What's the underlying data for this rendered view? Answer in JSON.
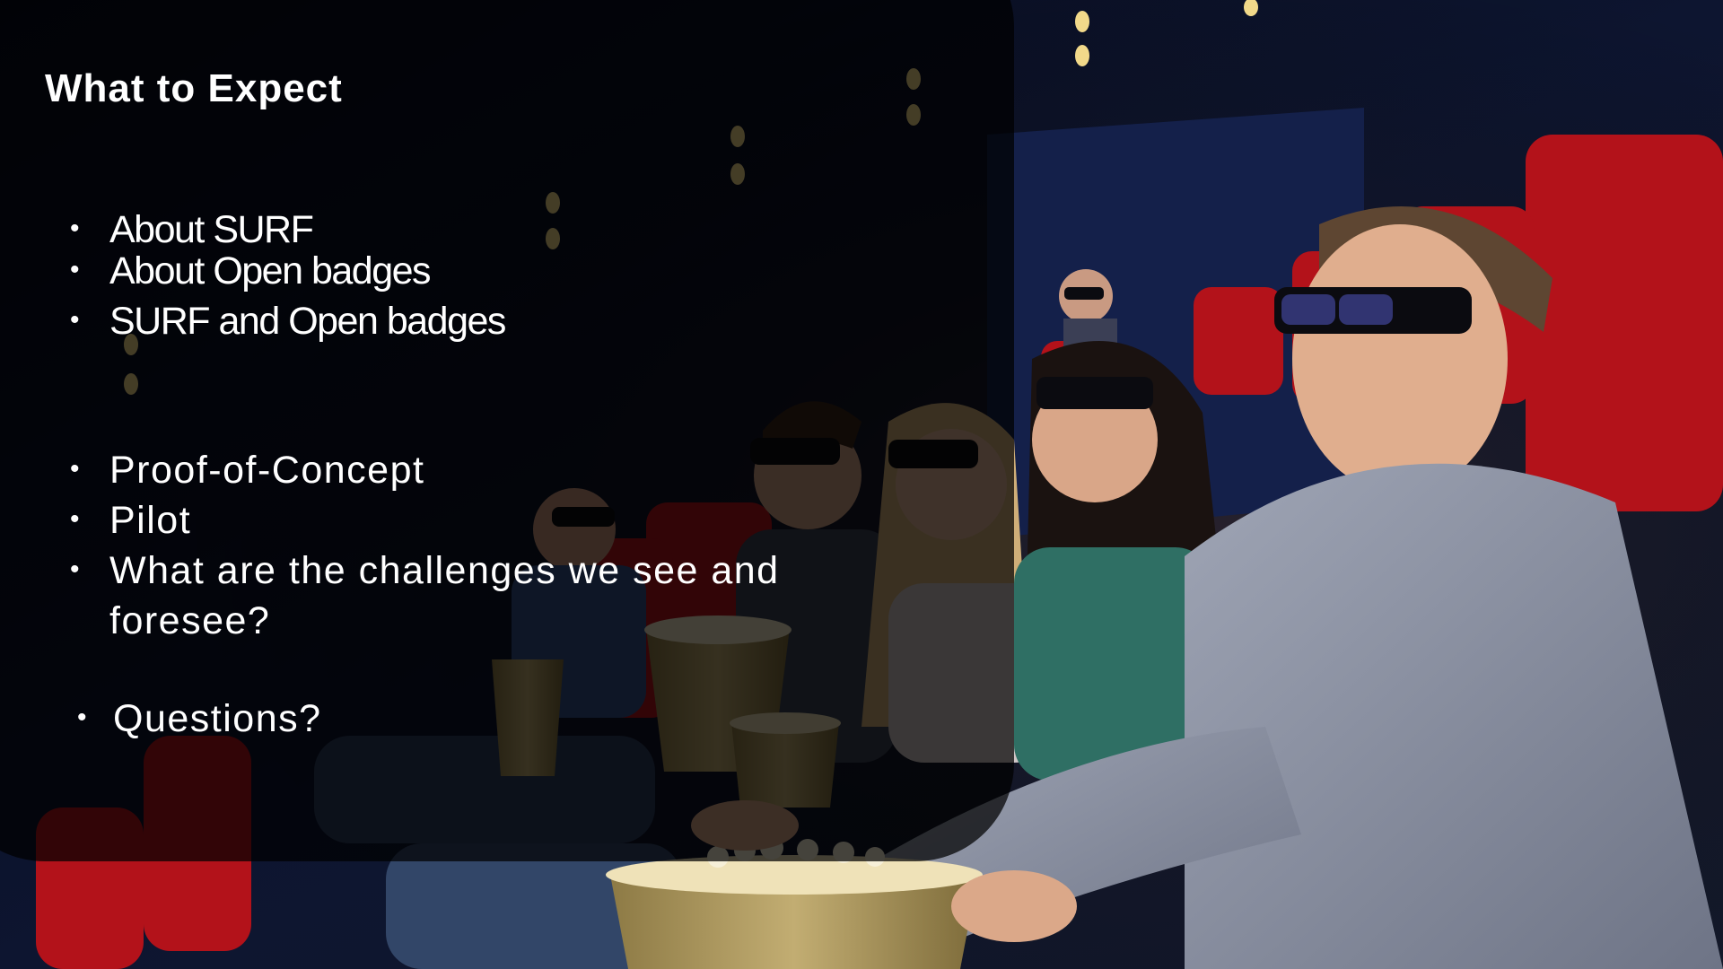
{
  "slide": {
    "title": "What to Expect",
    "bullets_group1": [
      "About SURF",
      "About Open badges",
      "SURF and Open badges"
    ],
    "bullets_group2": [
      "Proof-of-Concept",
      "Pilot",
      "What are the challenges we see and",
      "foresee?"
    ],
    "bullets_group3": [
      "Questions?"
    ],
    "bullet_glyph": "•"
  },
  "background": {
    "scene": "cinema-audience-3d-glasses-photo",
    "accent_seat_red": "#b3121a",
    "popcorn_cup_gold": "#b8a46a"
  }
}
